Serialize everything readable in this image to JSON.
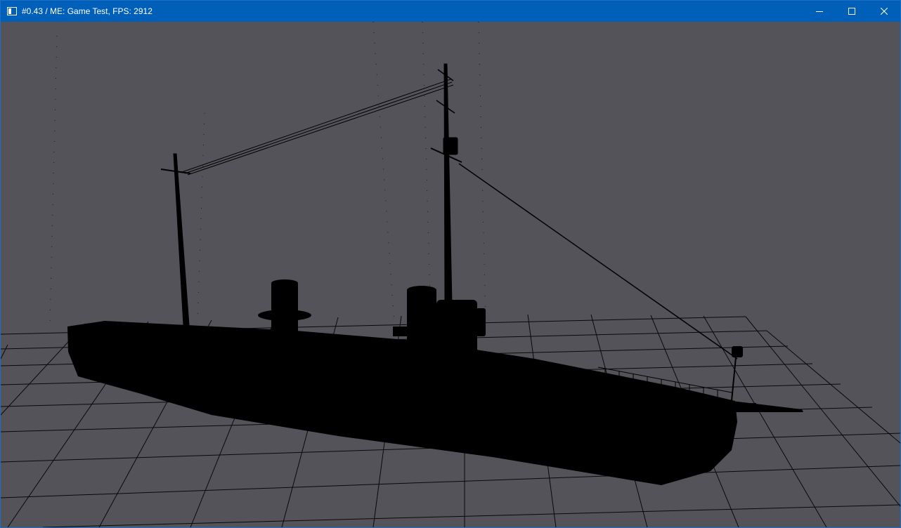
{
  "window": {
    "title": "#0.43 / ME: Game Test, FPS: 2912",
    "controls": {
      "minimize_icon": "minimize-icon",
      "maximize_icon": "maximize-icon",
      "close_icon": "close-icon"
    }
  },
  "scene": {
    "background_color": "#545359",
    "grid_color": "#000000",
    "ship_color": "#000000",
    "object": "ship-silhouette"
  }
}
